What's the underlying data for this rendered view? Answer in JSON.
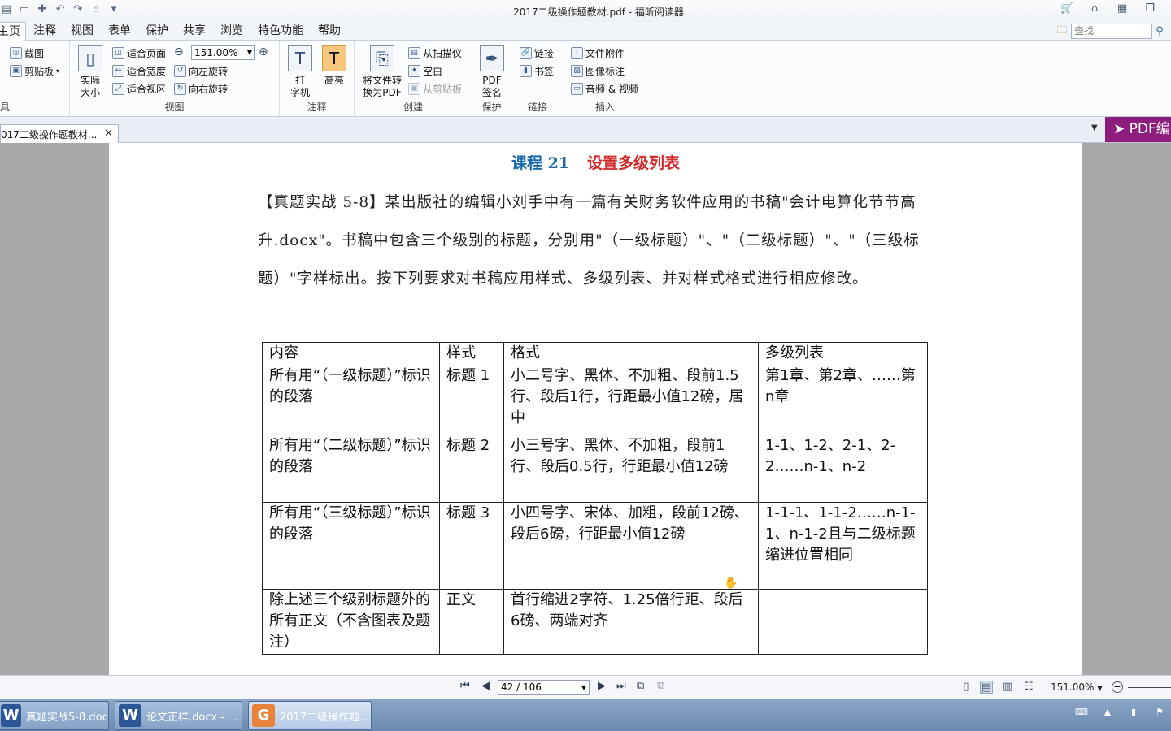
{
  "window": {
    "title": "2017二级操作题教材.pdf - 福昕阅读器"
  },
  "menu": {
    "tabs": [
      "主页",
      "注释",
      "视图",
      "表单",
      "保护",
      "共享",
      "浏览",
      "特色功能",
      "帮助"
    ],
    "active": "主页"
  },
  "search": {
    "placeholder": "查找"
  },
  "ribbon": {
    "tools": {
      "label": "具",
      "screenshot": "截图",
      "clipboard": "剪贴板"
    },
    "view": {
      "label": "视图",
      "actual_size": "实际\n大小",
      "fit_page": "适合页面",
      "fit_width": "适合宽度",
      "fit_visible": "适合视区",
      "zoom": "151.00%",
      "rotate_left": "向左旋转",
      "rotate_right": "向右旋转"
    },
    "comment": {
      "label": "注释",
      "typewriter": "打\n字机",
      "highlight": "高亮"
    },
    "create": {
      "label": "创建",
      "to_pdf": "将文件转\n换为PDF",
      "from_scanner": "从扫描仪",
      "blank": "空白",
      "from_clipboard": "从剪贴板"
    },
    "protect": {
      "label": "保护",
      "pdf_sign": "PDF\n签名"
    },
    "links": {
      "label": "链接",
      "link": "链接",
      "bookmark": "书签"
    },
    "insert": {
      "label": "插入",
      "attachment": "文件附件",
      "image_annot": "图像标注",
      "audio_video": "音频 & 视频"
    }
  },
  "doc_tab": {
    "label": "017二级操作题教材..."
  },
  "banner": {
    "text": "PDF编"
  },
  "document": {
    "lesson_num": "课程 21",
    "lesson_title": "设置多级列表",
    "paragraph": "【真题实战 5-8】某出版社的编辑小刘手中有一篇有关财务软件应用的书稿\"会计电算化节节高升.docx\"。书稿中包含三个级别的标题，分别用\"（一级标题）\"、\"（二级标题）\"、\"（三级标题）\"字样标出。按下列要求对书稿应用样式、多级列表、并对样式格式进行相应修改。",
    "table": {
      "headers": [
        "内容",
        "样式",
        "格式",
        "多级列表"
      ],
      "rows": [
        [
          "所有用“（一级标题）”标识的段落",
          "标题 1",
          "小二号字、黑体、不加粗、段前1.5行、段后1行，行距最小值12磅，居中",
          "第1章、第2章、……第n章"
        ],
        [
          "所有用“（二级标题）”标识的段落",
          "标题 2",
          "小三号字、黑体、不加粗，段前1行、段后0.5行，行距最小值12磅",
          "1-1、1-2、2-1、2-2……n-1、n-2"
        ],
        [
          "所有用“（三级标题）”标识的段落",
          "标题 3",
          "小四号字、宋体、加粗，段前12磅、段后6磅，行距最小值12磅",
          "1-1-1、1-1-2……n-1-1、n-1-2且与二级标题缩进位置相同"
        ],
        [
          "除上述三个级别标题外的所有正文（不含图表及题注）",
          "正文",
          "首行缩进2字符、1.25倍行距、段后6磅、两端对齐",
          ""
        ]
      ]
    }
  },
  "status": {
    "page": "42 / 106",
    "zoom": "151.00%"
  },
  "taskbar": {
    "items": [
      {
        "label": "真题实战5-8.doc...",
        "icon": "word-icon"
      },
      {
        "label": "论文正样.docx - ...",
        "icon": "word-icon"
      },
      {
        "label": "2017二级操作题...",
        "icon": "foxit-icon"
      }
    ]
  },
  "colors": {
    "lesson_num": "#1a6aa8",
    "lesson_title": "#d22a2a",
    "banner": "#8e1d7d",
    "page_bg": "#a9a9a9"
  }
}
